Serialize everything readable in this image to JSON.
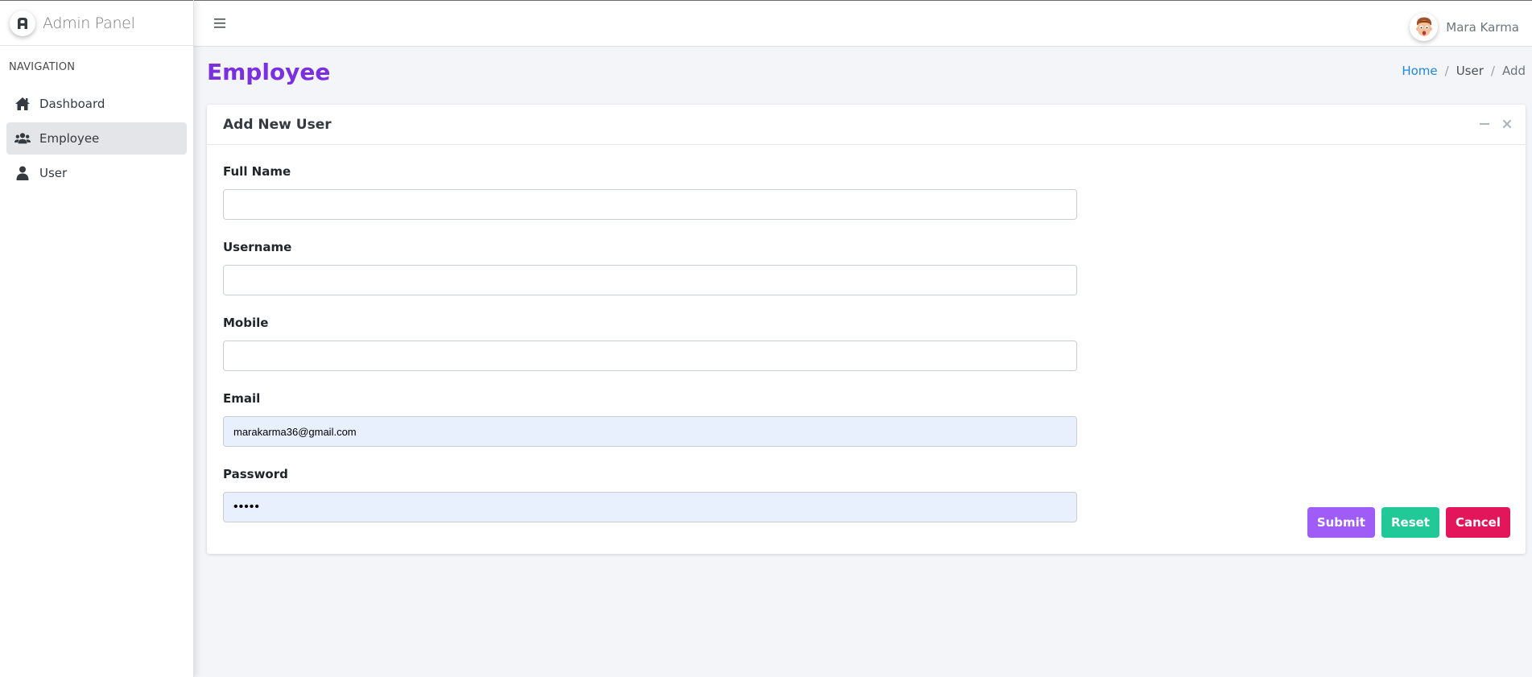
{
  "brand": {
    "name": "Admin Panel"
  },
  "sidebar": {
    "header": "NAVIGATION",
    "items": [
      {
        "label": "Dashboard",
        "icon": "home-icon",
        "active": false
      },
      {
        "label": "Employee",
        "icon": "users-icon",
        "active": true
      },
      {
        "label": "User",
        "icon": "user-icon",
        "active": false
      }
    ]
  },
  "topbar": {
    "menu_icon": "hamburger-icon",
    "user_name": "Mara Karma"
  },
  "page": {
    "title": "Employee",
    "breadcrumb": [
      "Home",
      "User",
      "Add"
    ]
  },
  "card": {
    "title": "Add New User",
    "tools": [
      "minimize-icon",
      "close-icon"
    ]
  },
  "form": {
    "full_name": {
      "label": "Full Name",
      "value": ""
    },
    "username": {
      "label": "Username",
      "value": ""
    },
    "mobile": {
      "label": "Mobile",
      "value": ""
    },
    "email": {
      "label": "Email",
      "value": "marakarma36@gmail.com"
    },
    "password": {
      "label": "Password",
      "value": "•••••"
    }
  },
  "buttons": {
    "submit": "Submit",
    "reset": "Reset",
    "cancel": "Cancel"
  },
  "colors": {
    "title": "#7a2fe0",
    "link": "#1e88e5",
    "submit": "#a05cf7",
    "reset": "#20c997",
    "cancel": "#e3165b",
    "autofill": "#e8f0fe"
  }
}
